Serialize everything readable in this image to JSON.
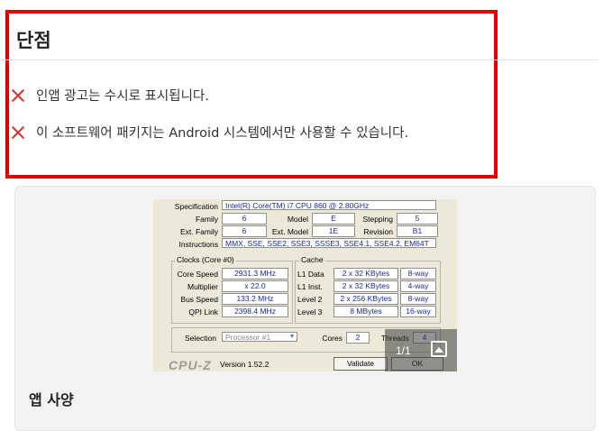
{
  "cons": {
    "title": "단점",
    "items": [
      "인앱 광고는 수시로 표시됩니다.",
      "이 소프트웨어 패키지는 Android 시스템에서만 사용할 수 있습니다."
    ],
    "highlight_color": "#e00000",
    "icon_color": "#d9342b"
  },
  "screenshot": {
    "labels": {
      "specification": "Specification",
      "family": "Family",
      "model": "Model",
      "stepping": "Stepping",
      "ext_family": "Ext. Family",
      "ext_model": "Ext. Model",
      "revision": "Revision",
      "instructions": "Instructions",
      "clocks_title": "Clocks (Core #0)",
      "core_speed": "Core Speed",
      "multiplier": "Multiplier",
      "bus_speed": "Bus Speed",
      "qpi_link": "QPI Link",
      "cache_title": "Cache",
      "l1_data": "L1 Data",
      "l1_inst": "L1 Inst.",
      "level2": "Level 2",
      "level3": "Level 3",
      "selection": "Selection",
      "cores": "Cores",
      "threads": "Threads",
      "version": "Version 1.52.2",
      "logo": "CPU-Z"
    },
    "values": {
      "specification": "Intel(R) Core(TM) i7 CPU        860  @ 2.80GHz",
      "family": "6",
      "model": "E",
      "stepping": "5",
      "ext_family": "6",
      "ext_model": "1E",
      "revision": "B1",
      "instructions": "MMX, SSE, SSE2, SSE3, SSSE3, SSE4.1, SSE4.2, EM64T",
      "core_speed": "2931.3 MHz",
      "multiplier": "x 22.0",
      "bus_speed": "133.2 MHz",
      "qpi_link": "2398.4 MHz",
      "l1_data": "2 x 32 KBytes",
      "l1_data_way": "8-way",
      "l1_inst": "2 x 32 KBytes",
      "l1_inst_way": "4-way",
      "level2": "2 x 256 KBytes",
      "level2_way": "8-way",
      "level3": "8 MBytes",
      "level3_way": "16-way",
      "selection": "Processor #1",
      "cores": "2",
      "threads": "4"
    },
    "buttons": {
      "validate": "Validate",
      "ok": "OK"
    },
    "counter": "1/1",
    "gallery_icon": "gallery-icon"
  },
  "app_spec": {
    "title": "앱 사양"
  }
}
